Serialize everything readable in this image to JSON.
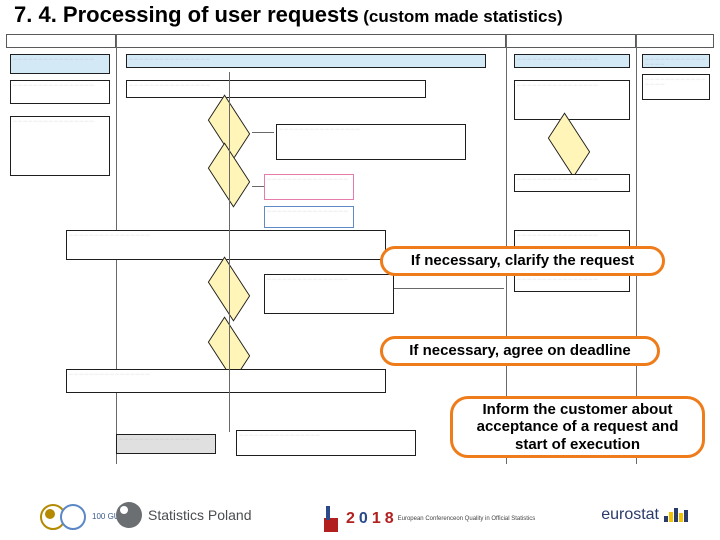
{
  "title": {
    "main": "7. 4. Processing of user requests",
    "sub": "(custom made statistics)"
  },
  "lanes": {
    "l1": "",
    "l2": "",
    "l3": "",
    "l4": ""
  },
  "callouts": {
    "c1": "If necessary, clarify the request",
    "c2": "If necessary, agree on deadline",
    "c3": "Inform the customer about acceptance of a request and start of execution"
  },
  "footer": {
    "gus_years": "100 GUS",
    "stats_poland": "Statistics Poland",
    "conf_year_a": "2",
    "conf_year_b": "0",
    "conf_year_c": "1",
    "conf_year_d": "8",
    "conf_caption1": "European Conference",
    "conf_caption2": "on Quality in Official Statistics",
    "eurostat": "eurostat"
  },
  "placeholder": "— — — — — — — — — — — — — — — —"
}
